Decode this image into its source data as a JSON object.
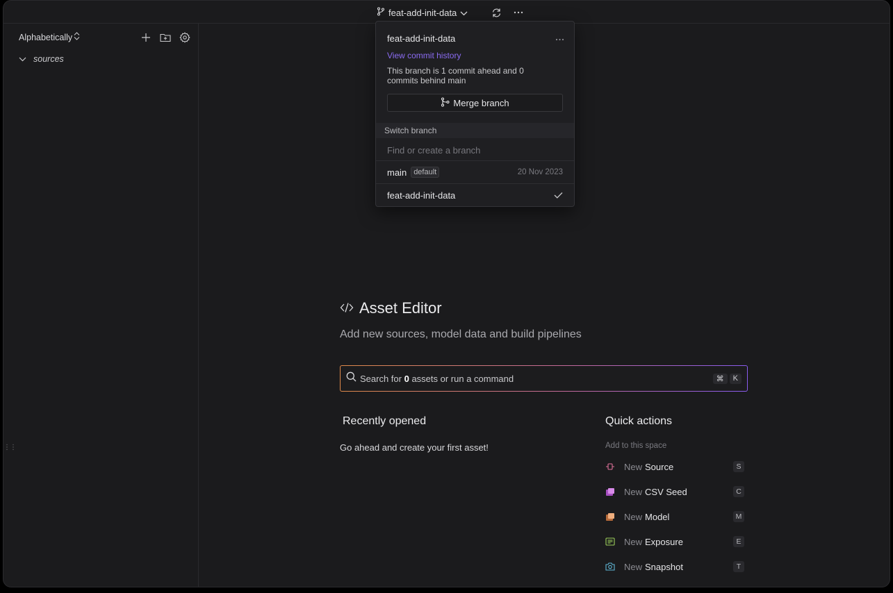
{
  "topbar": {
    "branch": "feat-add-init-data",
    "icons": [
      "git-branch-icon",
      "chevron-down-icon",
      "refresh-icon",
      "more-horizontal-icon"
    ]
  },
  "sidebar": {
    "sort_label": "Alphabetically",
    "icons": [
      "plus-icon",
      "new-folder-icon",
      "gear-icon"
    ],
    "tree": [
      {
        "label": "sources",
        "expanded": true
      }
    ]
  },
  "dropdown": {
    "title": "feat-add-init-data",
    "history_link": "View commit history",
    "status": "This branch is 1 commit ahead and 0 commits behind main",
    "merge_label": "Merge branch",
    "section_label": "Switch branch",
    "search_placeholder": "Find or create a branch",
    "branches": [
      {
        "name": "main",
        "badge": "default",
        "date": "20 Nov 2023"
      },
      {
        "name": "feat-add-init-data",
        "current": true
      }
    ]
  },
  "main": {
    "title": "Asset Editor",
    "subtitle": "Add new sources, model data and build pipelines",
    "search": {
      "prefix": "Search for ",
      "count": "0",
      "suffix": " assets or run a command",
      "shortcut_mod": "⌘",
      "shortcut_key": "K"
    },
    "recent": {
      "title": "Recently opened",
      "empty": "Go ahead and create your first asset!"
    },
    "quick_actions": {
      "title": "Quick actions",
      "subtitle": "Add to this space",
      "items": [
        {
          "new": "New",
          "name": "Source",
          "key": "S",
          "icon": "source-icon",
          "color": "#e0729a"
        },
        {
          "new": "New",
          "name": "CSV Seed",
          "key": "C",
          "icon": "csv-seed-icon",
          "color": "#c86fd6"
        },
        {
          "new": "New",
          "name": "Model",
          "key": "M",
          "icon": "model-icon",
          "color": "#e39a6a"
        },
        {
          "new": "New",
          "name": "Exposure",
          "key": "E",
          "icon": "exposure-icon",
          "color": "#9ccf5a"
        },
        {
          "new": "New",
          "name": "Snapshot",
          "key": "T",
          "icon": "snapshot-icon",
          "color": "#5fb7d6"
        }
      ]
    }
  },
  "colors": {
    "background": "#1b1b1d",
    "accent_link": "#8b6cf2",
    "search_gradient": [
      "#e08a4a",
      "#8a5cf0"
    ]
  }
}
